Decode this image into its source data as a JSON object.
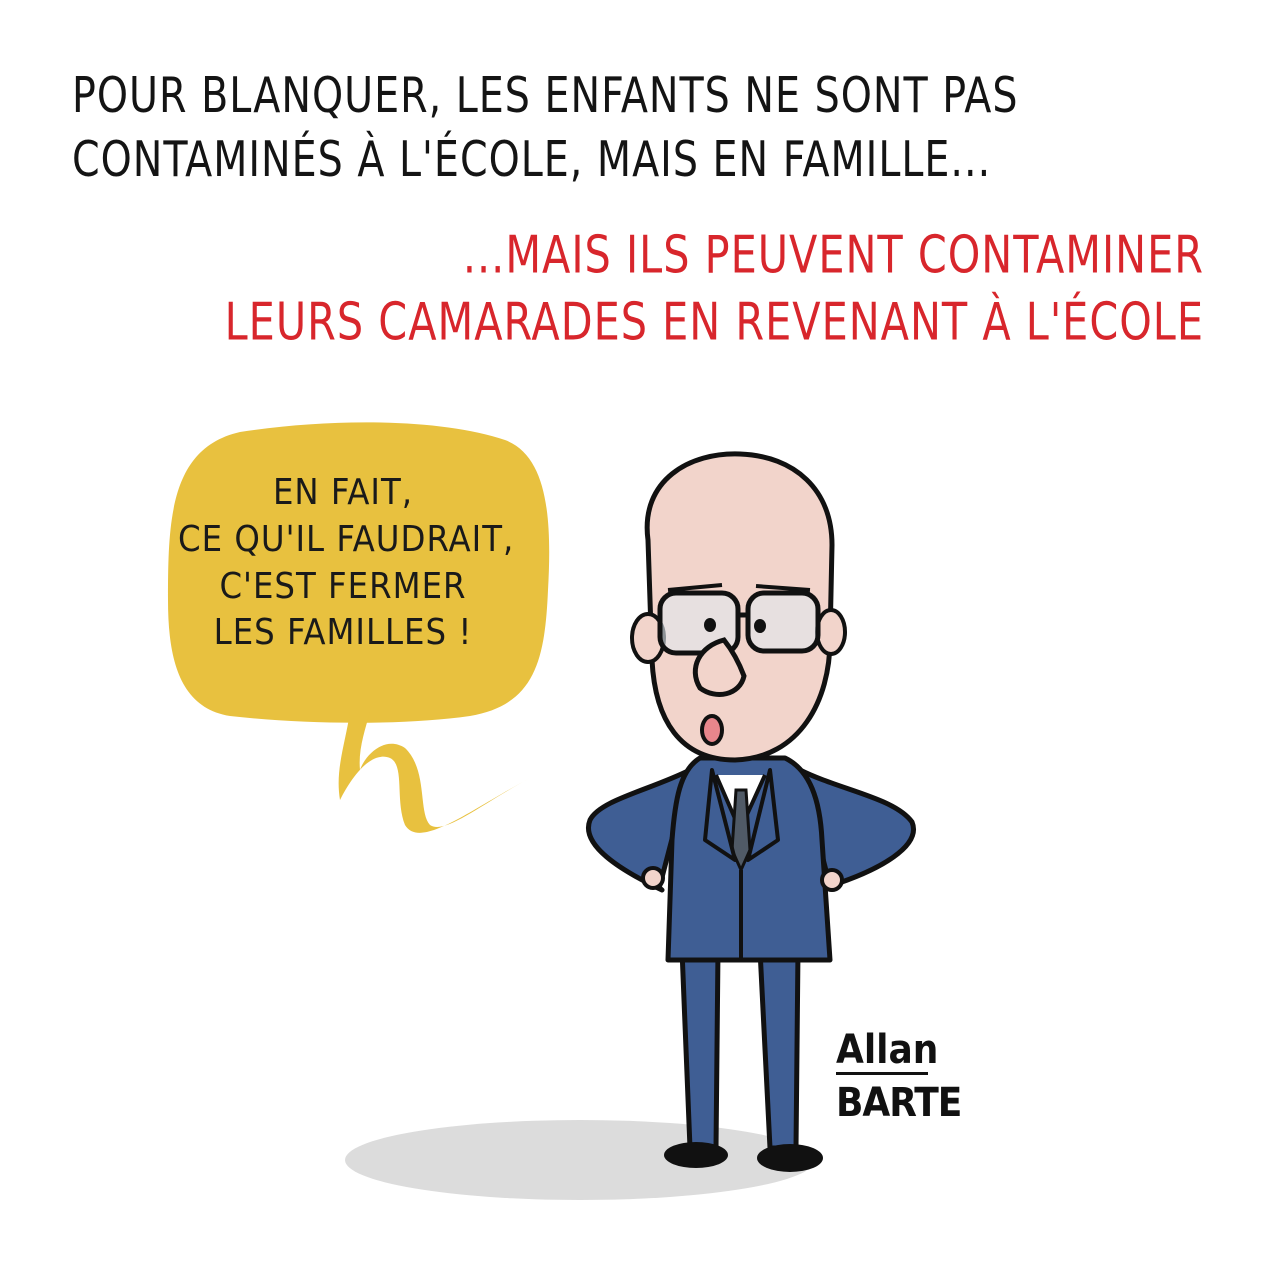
{
  "top_caption": {
    "lines": [
      "Pour Blanquer, les enfants ne sont pas",
      "contaminés à l'école, mais en famille..."
    ],
    "color": "#141414"
  },
  "red_caption": {
    "lines": [
      "...Mais ils peuvent contaminer",
      "leurs camarades en revenant à l'école"
    ],
    "color": "#d8262c"
  },
  "speech_bubble": {
    "lines": [
      "En fait,",
      "ce qu'il faudrait,",
      "c'est fermer",
      "les familles !"
    ],
    "color": "#e8c13f"
  },
  "character": {
    "suit_color": "#3f5e94",
    "skin_color": "#f2d4cb"
  },
  "signature": {
    "first": "Allan",
    "last": "BARTE"
  }
}
